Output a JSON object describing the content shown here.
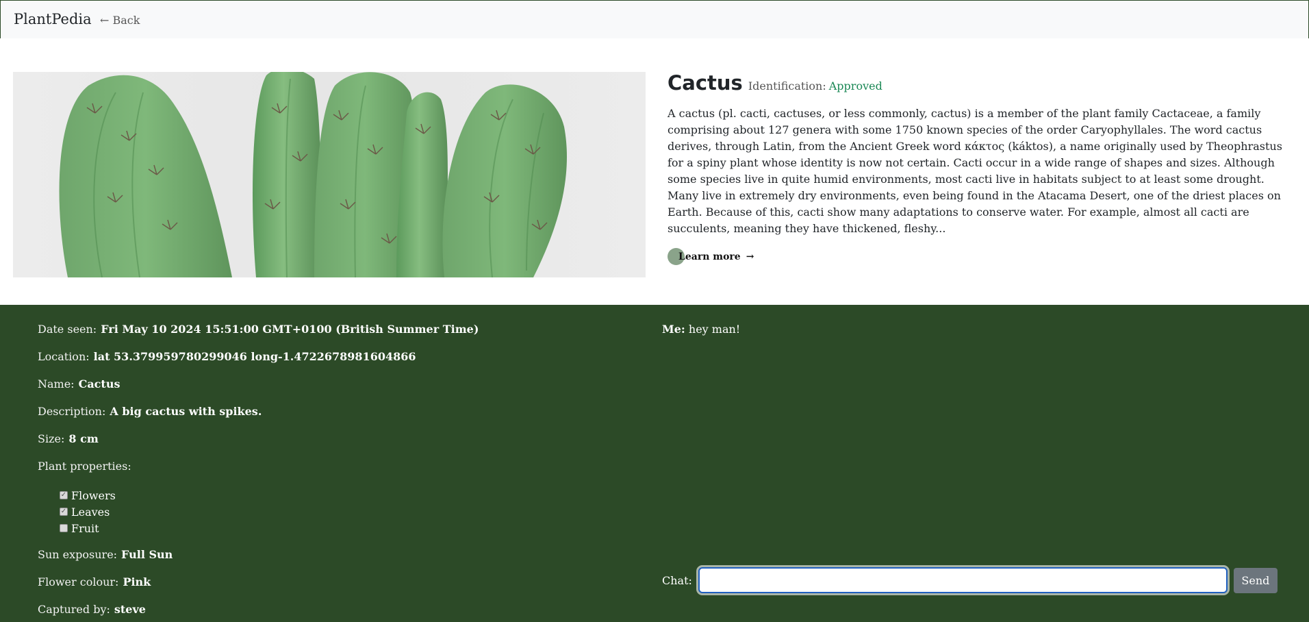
{
  "nav": {
    "brand": "PlantPedia",
    "back": "← Back"
  },
  "plant": {
    "title": "Cactus",
    "identification_label": "Identification:",
    "identification_status": "Approved",
    "description": "A cactus (pl. cacti, cactuses, or less commonly, cactus) is a member of the plant family Cactaceae, a family comprising about 127 genera with some 1750 known species of the order Caryophyllales. The word cactus derives, through Latin, from the Ancient Greek word κάκτος (káktos), a name originally used by Theophrastus for a spiny plant whose identity is now not certain. Cacti occur in a wide range of shapes and sizes. Although some species live in quite humid environments, most cacti live in habitats subject to at least some drought. Many live in extremely dry environments, even being found in the Atacama Desert, one of the driest places on Earth. Because of this, cacti show many adaptations to conserve water. For example, almost all cacti are succulents, meaning they have thickened, fleshy...",
    "learn_more": "Learn more",
    "learn_more_arrow": "→"
  },
  "details": {
    "date_seen": {
      "label": "Date seen:",
      "value": "Fri May 10 2024 15:51:00 GMT+0100 (British Summer Time)"
    },
    "location": {
      "label": "Location:",
      "value": "lat 53.379959780299046 long-1.4722678981604866"
    },
    "name": {
      "label": "Name:",
      "value": "Cactus"
    },
    "description": {
      "label": "Description:",
      "value": "A big cactus with spikes."
    },
    "size": {
      "label": "Size:",
      "value": "8 cm"
    },
    "properties_label": "Plant properties:",
    "properties": [
      {
        "label": "Flowers",
        "checked": true
      },
      {
        "label": "Leaves",
        "checked": true
      },
      {
        "label": "Fruit",
        "checked": false
      }
    ],
    "sun_exposure": {
      "label": "Sun exposure:",
      "value": "Full Sun"
    },
    "flower_colour": {
      "label": "Flower colour:",
      "value": "Pink"
    },
    "captured_by": {
      "label": "Captured by:",
      "value": "steve"
    }
  },
  "chat": {
    "messages": [
      {
        "sender": "Me:",
        "text": "hey man!"
      }
    ],
    "input_label": "Chat:",
    "input_value": "",
    "send_label": "Send"
  },
  "colors": {
    "details_bg": "#2c4a27",
    "approved": "#198754",
    "send_button": "#6c757d"
  }
}
